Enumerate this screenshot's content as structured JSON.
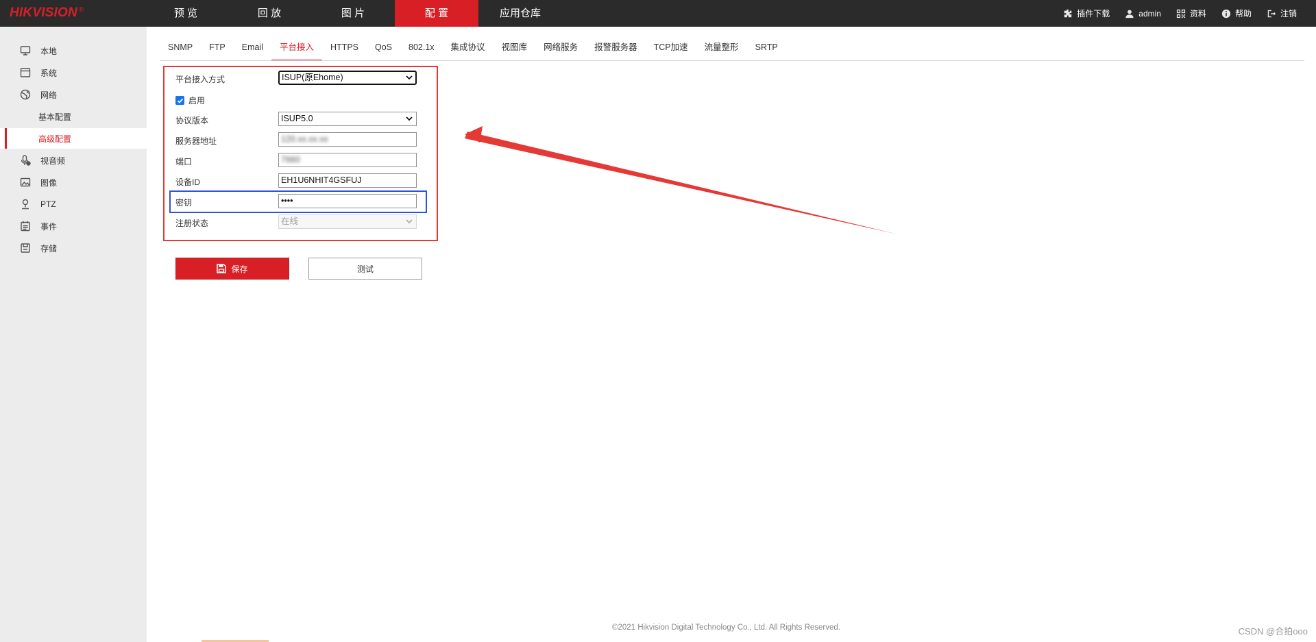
{
  "brand": {
    "name": "HIKVISION",
    "reg": "®"
  },
  "mainnav": [
    {
      "label": "预 览"
    },
    {
      "label": "回 放"
    },
    {
      "label": "图 片"
    },
    {
      "label": "配 置",
      "active": true
    },
    {
      "label": "应用仓库"
    }
  ],
  "toolbar": {
    "plugin_label": "插件下载",
    "user_label": "admin",
    "docs_label": "资料",
    "help_label": "帮助",
    "logout_label": "注销",
    "icons": [
      "puzzle-icon",
      "user-icon",
      "qrcode-icon",
      "help-icon",
      "logout-icon"
    ]
  },
  "sidebar": {
    "items": [
      {
        "label": "本地",
        "icon": "monitor-icon"
      },
      {
        "label": "系统",
        "icon": "system-icon"
      },
      {
        "label": "网络",
        "icon": "network-icon"
      },
      {
        "label": "基本配置",
        "sub": true
      },
      {
        "label": "高级配置",
        "sub": true,
        "active": true
      },
      {
        "label": "视音频",
        "icon": "mic-icon"
      },
      {
        "label": "图像",
        "icon": "image-icon"
      },
      {
        "label": "PTZ",
        "icon": "ptz-icon"
      },
      {
        "label": "事件",
        "icon": "event-icon"
      },
      {
        "label": "存储",
        "icon": "storage-icon"
      }
    ]
  },
  "tabs": [
    {
      "label": "SNMP"
    },
    {
      "label": "FTP"
    },
    {
      "label": "Email"
    },
    {
      "label": "平台接入",
      "active": true
    },
    {
      "label": "HTTPS"
    },
    {
      "label": "QoS"
    },
    {
      "label": "802.1x"
    },
    {
      "label": "集成协议"
    },
    {
      "label": "视图库"
    },
    {
      "label": "网络服务"
    },
    {
      "label": "报警服务器"
    },
    {
      "label": "TCP加速"
    },
    {
      "label": "流量整形"
    },
    {
      "label": "SRTP"
    }
  ],
  "form": {
    "access_mode": {
      "label": "平台接入方式",
      "value": "ISUP(原Ehome)"
    },
    "enable": {
      "label": "启用",
      "checked": true
    },
    "protocol": {
      "label": "协议版本",
      "value": "ISUP5.0"
    },
    "server": {
      "label": "服务器地址",
      "value": "120.xx.xx.xx"
    },
    "port": {
      "label": "端口",
      "value": "7660"
    },
    "device_id": {
      "label": "设备ID",
      "value": "EH1U6NHIT4GSFUJ"
    },
    "key": {
      "label": "密钥",
      "value": "••••"
    },
    "reg_status": {
      "label": "注册状态",
      "value": "在线"
    }
  },
  "buttons": {
    "save_label": "保存",
    "test_label": "测试"
  },
  "colors": {
    "accent": "#d91f26",
    "topbar": "#2b2b2b",
    "sidebar": "#ececec",
    "highlight_red": "#e53935",
    "highlight_blue": "#2f54d6"
  },
  "footer": {
    "copyright": "©2021 Hikvision Digital Technology Co., Ltd. All Rights Reserved.",
    "watermark": "CSDN @合拍ooo"
  }
}
